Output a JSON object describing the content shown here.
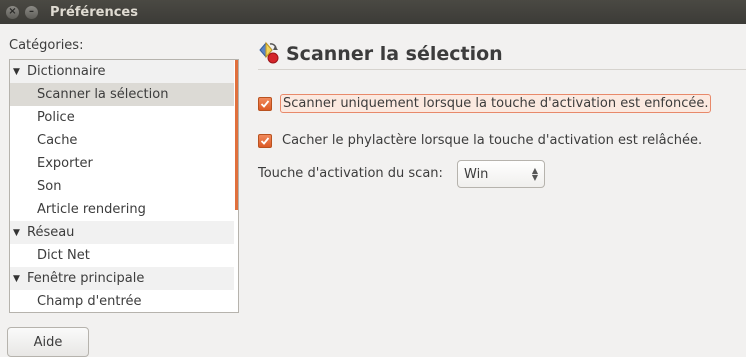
{
  "window": {
    "title": "Préférences",
    "close_glyph": "×",
    "minimize_glyph": "–",
    "maximize_glyph": "□"
  },
  "categories_label": "Catégories:",
  "tree": [
    {
      "label": "Dictionnaire",
      "type": "parent",
      "expanded": true
    },
    {
      "label": "Scanner la sélection",
      "type": "child",
      "selected": true
    },
    {
      "label": "Police",
      "type": "child"
    },
    {
      "label": "Cache",
      "type": "child"
    },
    {
      "label": "Exporter",
      "type": "child"
    },
    {
      "label": "Son",
      "type": "child"
    },
    {
      "label": "Article rendering",
      "type": "child"
    },
    {
      "label": "Réseau",
      "type": "parent",
      "expanded": true
    },
    {
      "label": "Dict Net",
      "type": "child"
    },
    {
      "label": "Fenêtre principale",
      "type": "parent",
      "expanded": true
    },
    {
      "label": "Champ d'entrée",
      "type": "child"
    }
  ],
  "page": {
    "title": "Scanner la sélection",
    "icon": "scan-selection-icon",
    "options": [
      {
        "label": "Scanner uniquement lorsque la touche d'activation est enfoncée.",
        "checked": true,
        "focused": true
      },
      {
        "label": "Cacher le phylactère lorsque la touche d'activation est relâchée.",
        "checked": true,
        "focused": false
      }
    ],
    "scan_key_label": "Touche d'activation du scan:",
    "scan_key_value": "Win"
  },
  "help_button": "Aide",
  "colors": {
    "accent": "#dd5a26",
    "titlebar": "#3c3b37"
  }
}
